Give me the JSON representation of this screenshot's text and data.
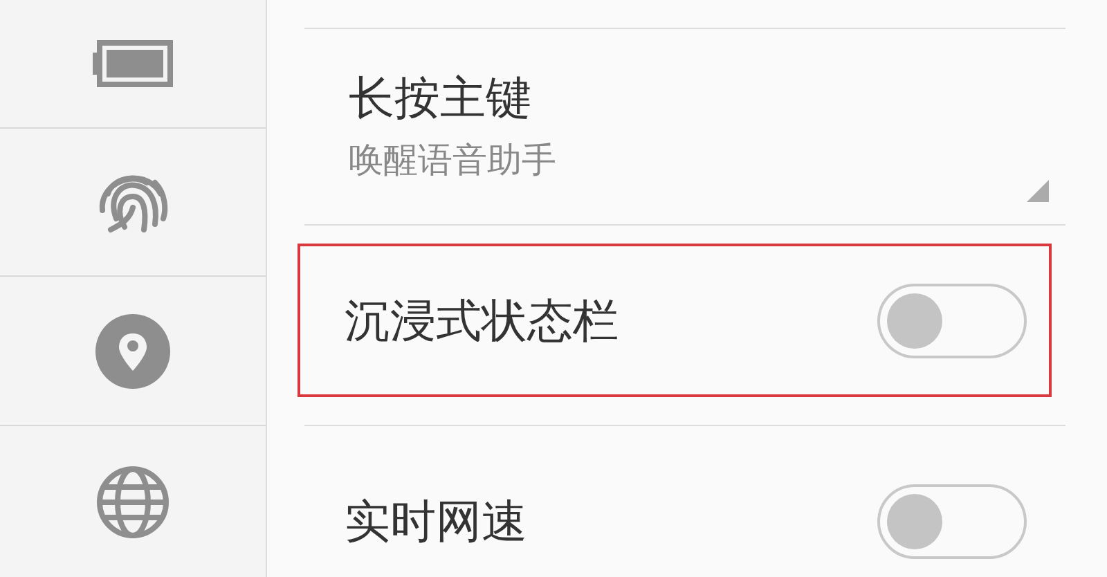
{
  "settings": [
    {
      "kind": "dropdown",
      "title": "长按主键",
      "value": "唤醒语音助手"
    },
    {
      "kind": "toggle",
      "title": "沉浸式状态栏",
      "on": false,
      "highlighted": true
    },
    {
      "kind": "toggle",
      "title": "实时网速",
      "on": false,
      "highlighted": false
    }
  ]
}
